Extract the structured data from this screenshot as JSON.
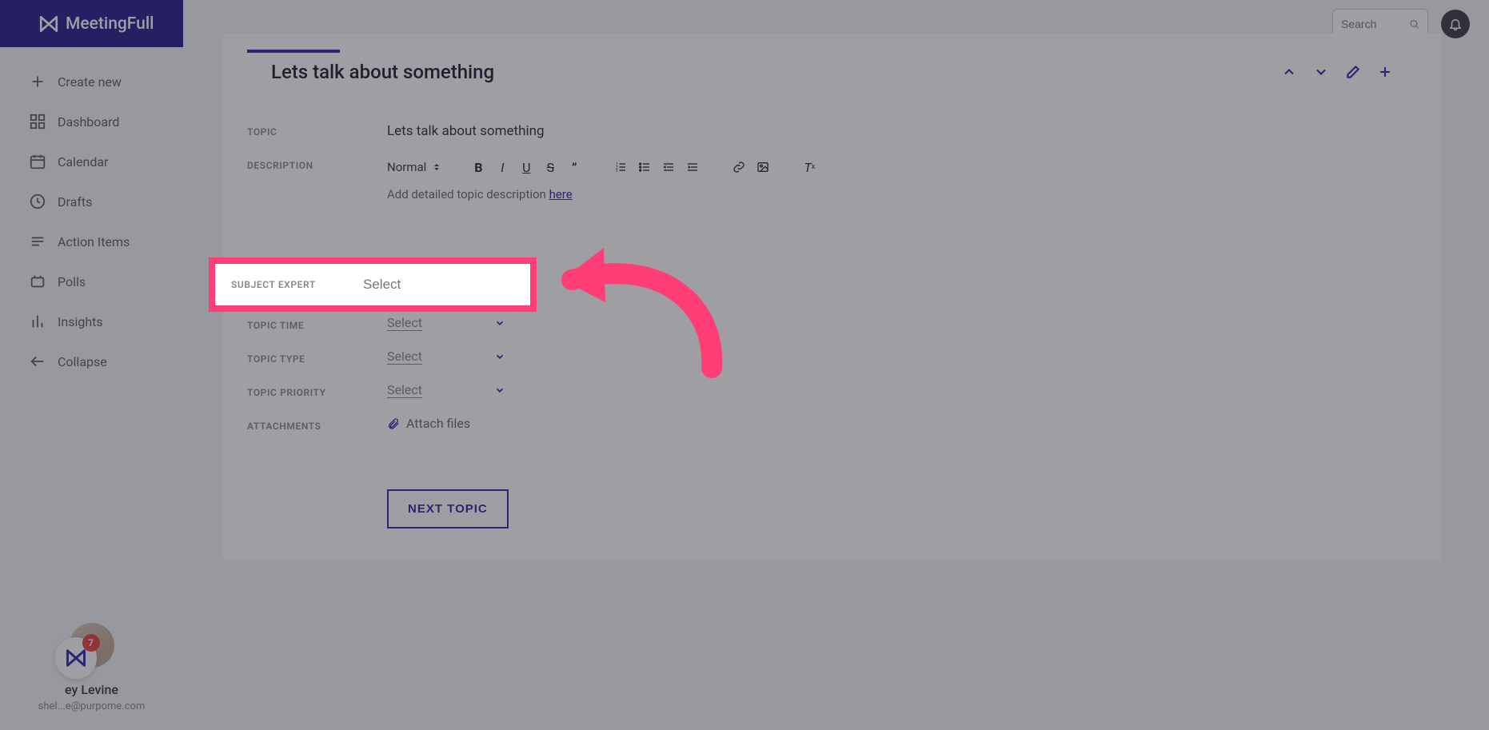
{
  "app": {
    "name": "MeetingFull"
  },
  "search": {
    "placeholder": "Search"
  },
  "sidebar": {
    "create": "Create new",
    "items": [
      {
        "label": "Dashboard"
      },
      {
        "label": "Calendar"
      },
      {
        "label": "Drafts"
      },
      {
        "label": "Action Items"
      },
      {
        "label": "Polls"
      },
      {
        "label": "Insights"
      }
    ],
    "collapse": "Collapse"
  },
  "user": {
    "name": "ey Levine",
    "email": "shel...e@purpome.com",
    "badge_count": "7"
  },
  "card": {
    "title": "Lets talk about something",
    "labels": {
      "topic": "TOPIC",
      "description": "DESCRIPTION",
      "subject_expert": "SUBJECT EXPERT",
      "topic_time": "TOPIC TIME",
      "topic_type": "TOPIC TYPE",
      "topic_priority": "TOPIC PRIORITY",
      "attachments": "ATTACHMENTS"
    },
    "topic_value": "Lets talk about something",
    "editor": {
      "style_select": "Normal",
      "placeholder_prefix": "Add detailed topic description ",
      "placeholder_link": "here"
    },
    "subject_expert_placeholder": "Select",
    "select_placeholder": "Select",
    "attach_label": "Attach files",
    "next_button": "NEXT TOPIC"
  }
}
